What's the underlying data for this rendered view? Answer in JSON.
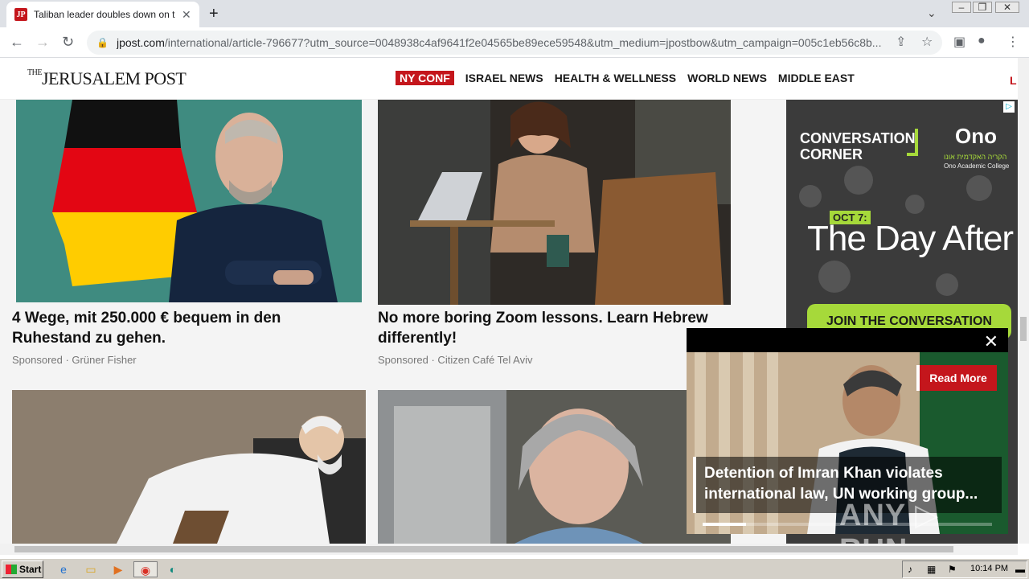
{
  "browser": {
    "tab_title": "Taliban leader doubles down on treat",
    "tab_close": "✕",
    "new_tab": "+",
    "favicon_text": "JP",
    "url_host": "jpost.com",
    "url_path": "/international/article-796677?utm_source=0048938c4af9641f2e04565be89ece59548&utm_medium=jpostbow&utm_campaign=005c1eb56c8b...",
    "icons": [
      "back-icon",
      "forward-icon",
      "reload-icon",
      "lock-icon",
      "share-icon",
      "star-icon",
      "sidebar-icon",
      "profile-icon",
      "menu-icon"
    ]
  },
  "site": {
    "logo_the": "THE",
    "logo_name": "JERUSALEM POST",
    "nav": [
      {
        "label": "NY CONF",
        "highlight": true
      },
      {
        "label": "ISRAEL NEWS"
      },
      {
        "label": "HEALTH & WELLNESS"
      },
      {
        "label": "WORLD NEWS"
      },
      {
        "label": "MIDDLE EAST"
      }
    ],
    "nav_tail": "L"
  },
  "cards": [
    {
      "title": "4 Wege, mit 250.000 € bequem in den Ruhestand zu gehen.",
      "meta": "Sponsored · Grüner Fisher"
    },
    {
      "title": "No more boring Zoom lessons. Learn Hebrew differently!",
      "meta": "Sponsored · Citizen Café Tel Aviv"
    }
  ],
  "ad": {
    "conv_line1": "CONVERSATION",
    "conv_line2": "CORNER",
    "ono": "Ono",
    "ono_sub": "הקריה האקדמית אונו",
    "ono_sub2": "Ono Academic College",
    "oct": "OCT 7:",
    "headline": "The Day After",
    "cta": "JOIN THE CONVERSATION",
    "info": "▷"
  },
  "video": {
    "read_more": "Read More",
    "caption": "Detention of Imran Khan violates international law, UN working group...",
    "close": "✕",
    "progress": 0.15,
    "watermark": "ANY ▷ RUN"
  },
  "taskbar": {
    "start": "Start",
    "clock": "10:14 PM"
  },
  "colors": {
    "brand_red": "#c4161c",
    "ad_green": "#a6d93a"
  }
}
